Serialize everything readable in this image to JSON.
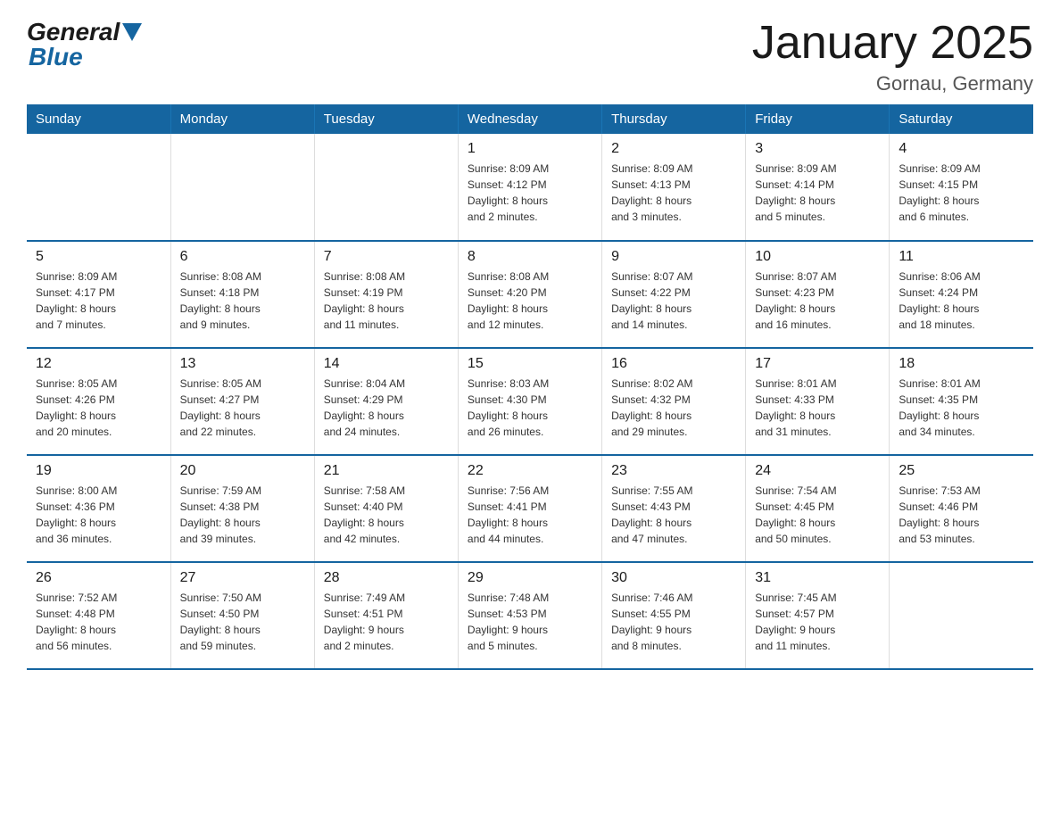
{
  "header": {
    "logo_general": "General",
    "logo_blue": "Blue",
    "title": "January 2025",
    "subtitle": "Gornau, Germany"
  },
  "calendar": {
    "days_of_week": [
      "Sunday",
      "Monday",
      "Tuesday",
      "Wednesday",
      "Thursday",
      "Friday",
      "Saturday"
    ],
    "weeks": [
      [
        {
          "day": "",
          "info": ""
        },
        {
          "day": "",
          "info": ""
        },
        {
          "day": "",
          "info": ""
        },
        {
          "day": "1",
          "info": "Sunrise: 8:09 AM\nSunset: 4:12 PM\nDaylight: 8 hours\nand 2 minutes."
        },
        {
          "day": "2",
          "info": "Sunrise: 8:09 AM\nSunset: 4:13 PM\nDaylight: 8 hours\nand 3 minutes."
        },
        {
          "day": "3",
          "info": "Sunrise: 8:09 AM\nSunset: 4:14 PM\nDaylight: 8 hours\nand 5 minutes."
        },
        {
          "day": "4",
          "info": "Sunrise: 8:09 AM\nSunset: 4:15 PM\nDaylight: 8 hours\nand 6 minutes."
        }
      ],
      [
        {
          "day": "5",
          "info": "Sunrise: 8:09 AM\nSunset: 4:17 PM\nDaylight: 8 hours\nand 7 minutes."
        },
        {
          "day": "6",
          "info": "Sunrise: 8:08 AM\nSunset: 4:18 PM\nDaylight: 8 hours\nand 9 minutes."
        },
        {
          "day": "7",
          "info": "Sunrise: 8:08 AM\nSunset: 4:19 PM\nDaylight: 8 hours\nand 11 minutes."
        },
        {
          "day": "8",
          "info": "Sunrise: 8:08 AM\nSunset: 4:20 PM\nDaylight: 8 hours\nand 12 minutes."
        },
        {
          "day": "9",
          "info": "Sunrise: 8:07 AM\nSunset: 4:22 PM\nDaylight: 8 hours\nand 14 minutes."
        },
        {
          "day": "10",
          "info": "Sunrise: 8:07 AM\nSunset: 4:23 PM\nDaylight: 8 hours\nand 16 minutes."
        },
        {
          "day": "11",
          "info": "Sunrise: 8:06 AM\nSunset: 4:24 PM\nDaylight: 8 hours\nand 18 minutes."
        }
      ],
      [
        {
          "day": "12",
          "info": "Sunrise: 8:05 AM\nSunset: 4:26 PM\nDaylight: 8 hours\nand 20 minutes."
        },
        {
          "day": "13",
          "info": "Sunrise: 8:05 AM\nSunset: 4:27 PM\nDaylight: 8 hours\nand 22 minutes."
        },
        {
          "day": "14",
          "info": "Sunrise: 8:04 AM\nSunset: 4:29 PM\nDaylight: 8 hours\nand 24 minutes."
        },
        {
          "day": "15",
          "info": "Sunrise: 8:03 AM\nSunset: 4:30 PM\nDaylight: 8 hours\nand 26 minutes."
        },
        {
          "day": "16",
          "info": "Sunrise: 8:02 AM\nSunset: 4:32 PM\nDaylight: 8 hours\nand 29 minutes."
        },
        {
          "day": "17",
          "info": "Sunrise: 8:01 AM\nSunset: 4:33 PM\nDaylight: 8 hours\nand 31 minutes."
        },
        {
          "day": "18",
          "info": "Sunrise: 8:01 AM\nSunset: 4:35 PM\nDaylight: 8 hours\nand 34 minutes."
        }
      ],
      [
        {
          "day": "19",
          "info": "Sunrise: 8:00 AM\nSunset: 4:36 PM\nDaylight: 8 hours\nand 36 minutes."
        },
        {
          "day": "20",
          "info": "Sunrise: 7:59 AM\nSunset: 4:38 PM\nDaylight: 8 hours\nand 39 minutes."
        },
        {
          "day": "21",
          "info": "Sunrise: 7:58 AM\nSunset: 4:40 PM\nDaylight: 8 hours\nand 42 minutes."
        },
        {
          "day": "22",
          "info": "Sunrise: 7:56 AM\nSunset: 4:41 PM\nDaylight: 8 hours\nand 44 minutes."
        },
        {
          "day": "23",
          "info": "Sunrise: 7:55 AM\nSunset: 4:43 PM\nDaylight: 8 hours\nand 47 minutes."
        },
        {
          "day": "24",
          "info": "Sunrise: 7:54 AM\nSunset: 4:45 PM\nDaylight: 8 hours\nand 50 minutes."
        },
        {
          "day": "25",
          "info": "Sunrise: 7:53 AM\nSunset: 4:46 PM\nDaylight: 8 hours\nand 53 minutes."
        }
      ],
      [
        {
          "day": "26",
          "info": "Sunrise: 7:52 AM\nSunset: 4:48 PM\nDaylight: 8 hours\nand 56 minutes."
        },
        {
          "day": "27",
          "info": "Sunrise: 7:50 AM\nSunset: 4:50 PM\nDaylight: 8 hours\nand 59 minutes."
        },
        {
          "day": "28",
          "info": "Sunrise: 7:49 AM\nSunset: 4:51 PM\nDaylight: 9 hours\nand 2 minutes."
        },
        {
          "day": "29",
          "info": "Sunrise: 7:48 AM\nSunset: 4:53 PM\nDaylight: 9 hours\nand 5 minutes."
        },
        {
          "day": "30",
          "info": "Sunrise: 7:46 AM\nSunset: 4:55 PM\nDaylight: 9 hours\nand 8 minutes."
        },
        {
          "day": "31",
          "info": "Sunrise: 7:45 AM\nSunset: 4:57 PM\nDaylight: 9 hours\nand 11 minutes."
        },
        {
          "day": "",
          "info": ""
        }
      ]
    ]
  }
}
